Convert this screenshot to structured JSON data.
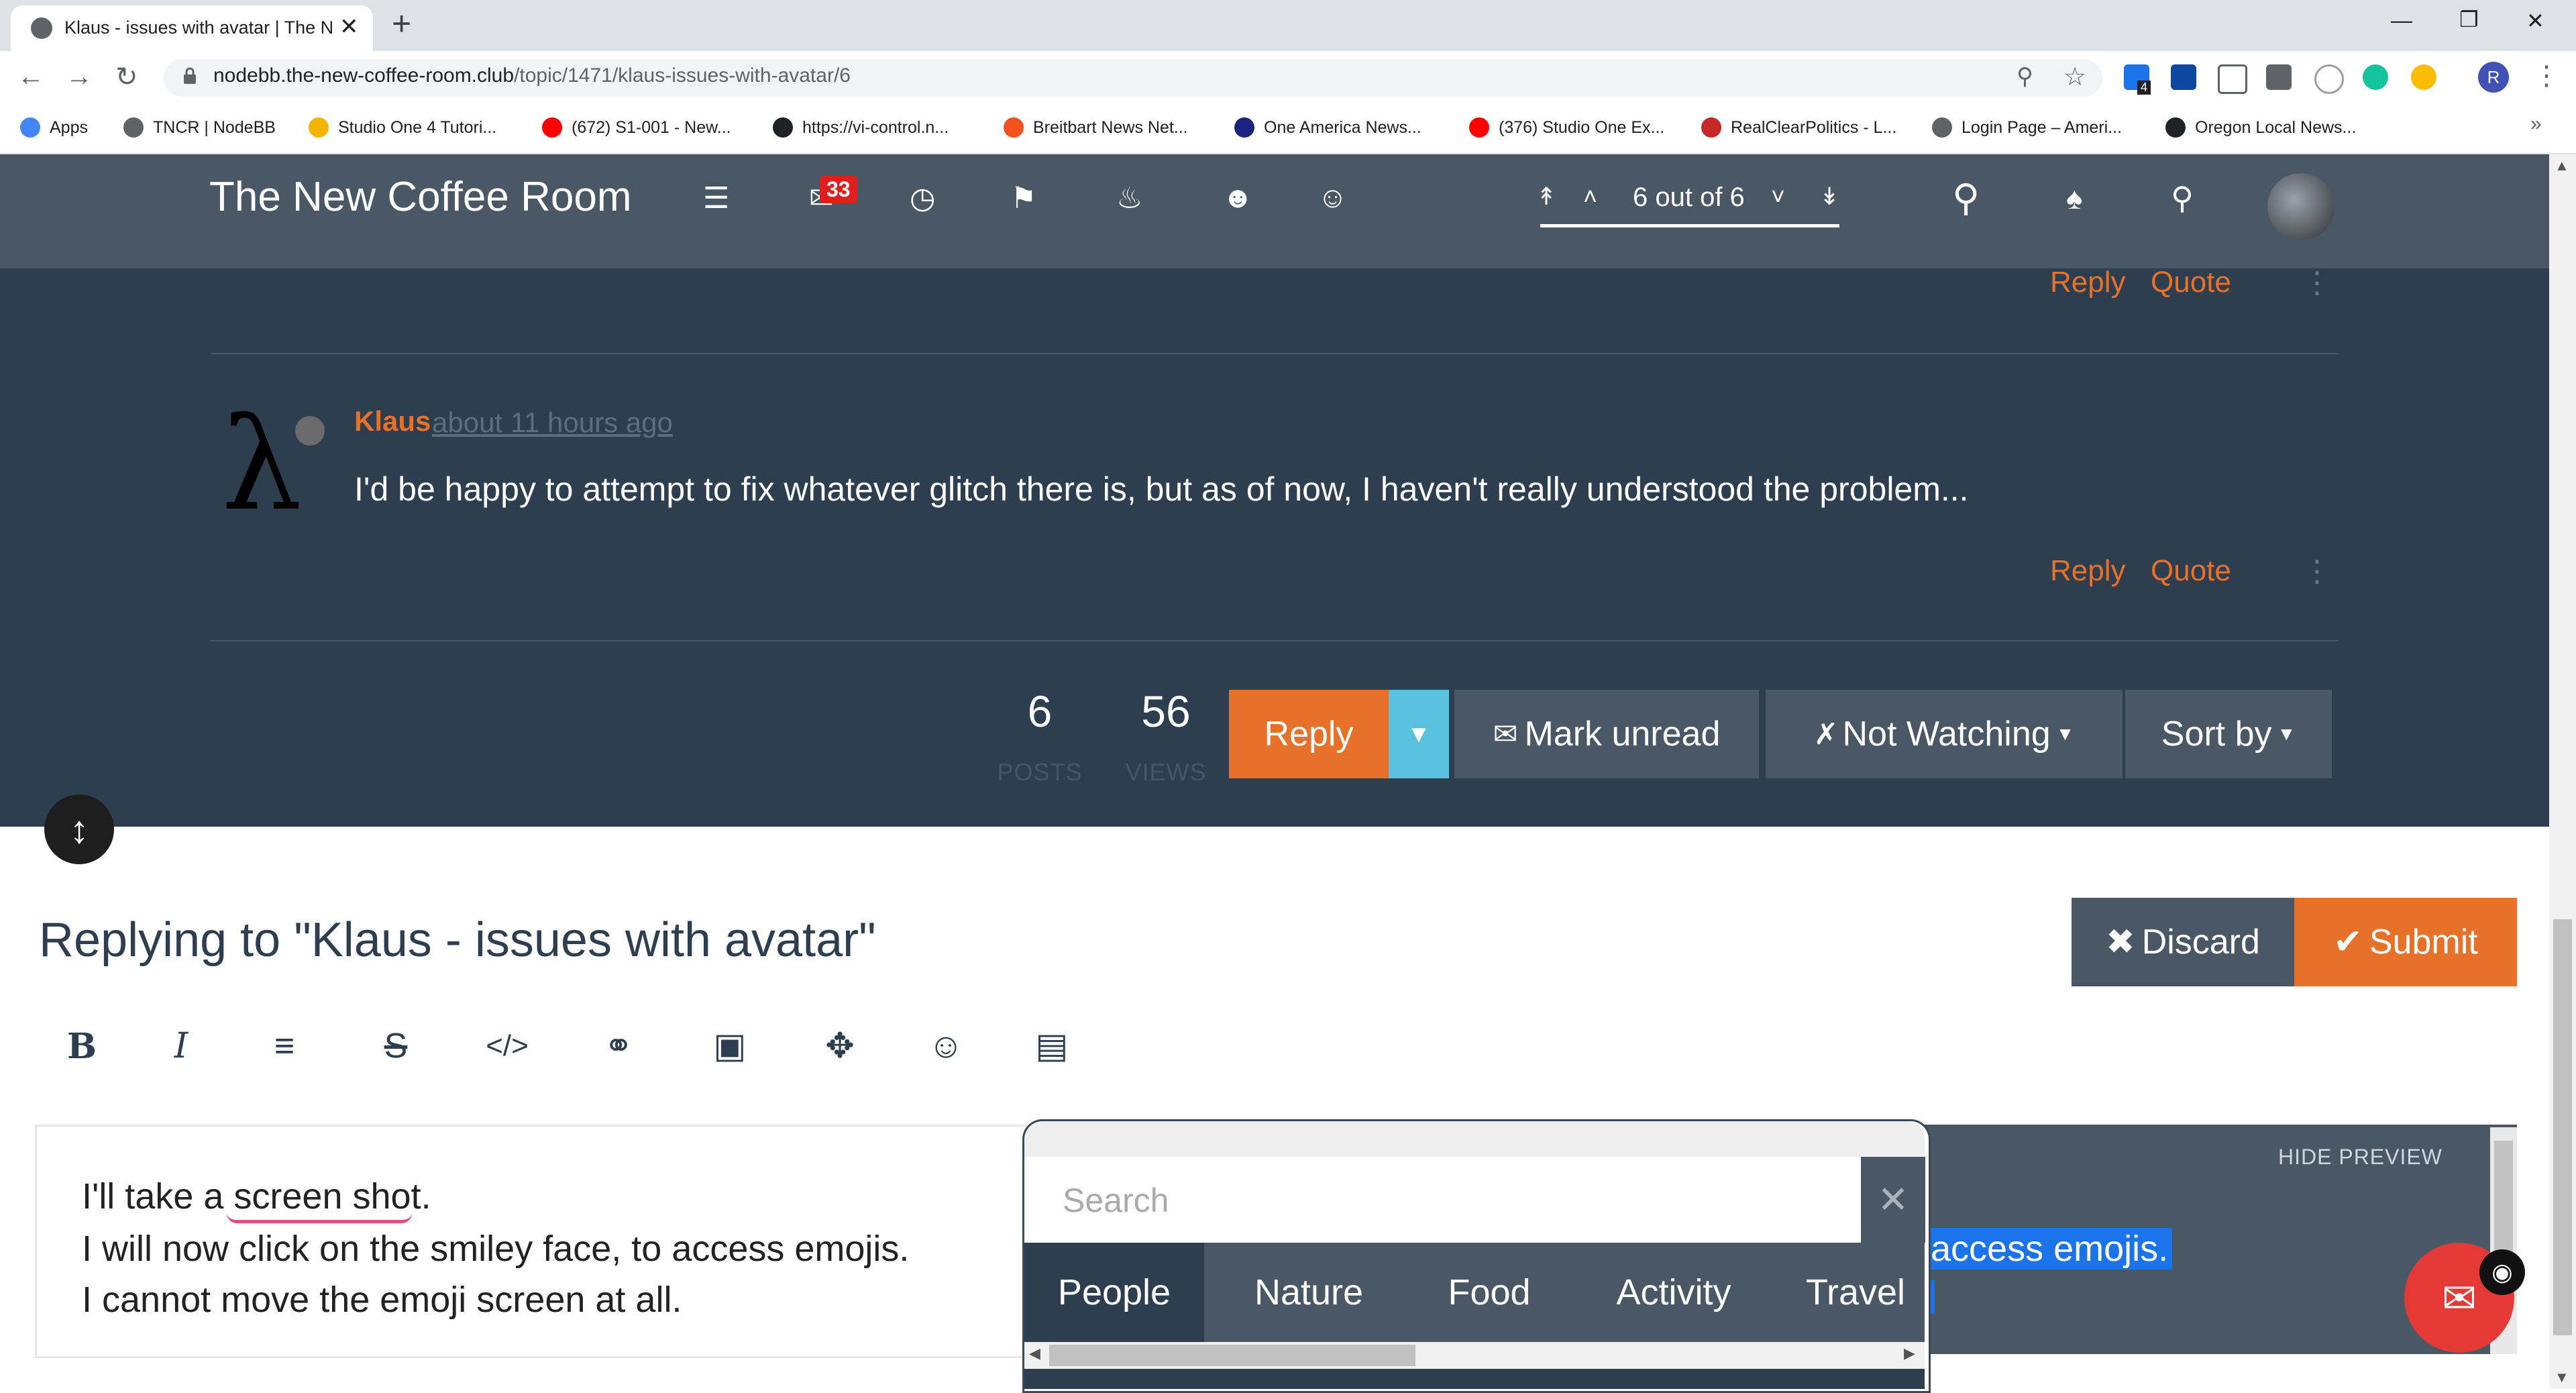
{
  "browser": {
    "tab_title": "Klaus - issues with avatar | The N",
    "tab_close": "✕",
    "new_tab": "+",
    "url_domain": "nodebb.the-new-coffee-room.club",
    "url_path": "/topic/1471/klaus-issues-with-avatar/6",
    "ext_badge": "4",
    "bookmarks": [
      {
        "label": "Apps",
        "icon": "apps-grid-icon",
        "color": "#4285f4"
      },
      {
        "label": "TNCR | NodeBB",
        "icon": "globe-icon",
        "color": "#5f6368"
      },
      {
        "label": "Studio One 4 Tutori...",
        "icon": "bars-icon",
        "color": "#f4b400"
      },
      {
        "label": "(672) S1-001 - New...",
        "icon": "youtube-icon",
        "color": "#ff0000"
      },
      {
        "label": "https://vi-control.n...",
        "icon": "g-icon",
        "color": "#202124"
      },
      {
        "label": "Breitbart News Net...",
        "icon": "b-icon",
        "color": "#f4511e"
      },
      {
        "label": "One America News...",
        "icon": "oan-icon",
        "color": "#1a237e"
      },
      {
        "label": "(376) Studio One Ex...",
        "icon": "youtube-icon",
        "color": "#ff0000"
      },
      {
        "label": "RealClearPolitics - L...",
        "icon": "rcp-icon",
        "color": "#c62828"
      },
      {
        "label": "Login Page – Ameri...",
        "icon": "globe-icon",
        "color": "#5f6368"
      },
      {
        "label": "Oregon Local News...",
        "icon": "oregon-icon",
        "color": "#202124"
      }
    ],
    "bookmarks_more": "»"
  },
  "navbar": {
    "brand": "The New Coffee Room",
    "notification_count": "33",
    "pager": "6 out of 6"
  },
  "post": {
    "actions_top": {
      "reply": "Reply",
      "quote": "Quote"
    },
    "avatar_glyph": "λ",
    "author": "Klaus",
    "timestamp": "about 11 hours ago",
    "body": "I'd be happy to attempt to fix whatever glitch there is, but as of now, I haven't really understood the problem...",
    "actions": {
      "reply": "Reply",
      "quote": "Quote"
    }
  },
  "topic_footer": {
    "posts_count": "6",
    "posts_label": "POSTS",
    "views_count": "56",
    "views_label": "VIEWS",
    "reply_button": "Reply",
    "mark_unread": "Mark unread",
    "watching": "Not Watching",
    "sort_by": "Sort by"
  },
  "composer": {
    "title": "Replying to \"Klaus - issues with avatar\"",
    "discard": "Discard",
    "submit": "Submit",
    "lines": [
      "I'll take a screen shot.",
      "I will now click on the smiley face, to access emojis.",
      "I cannot move the emoji screen at all."
    ],
    "hide_preview": "HIDE PREVIEW",
    "preview_selected": "access emojis."
  },
  "emoji_picker": {
    "search_placeholder": "Search",
    "close": "✕",
    "tabs": [
      "People",
      "Nature",
      "Food",
      "Activity",
      "Travel"
    ],
    "active_tab": "People"
  },
  "colors": {
    "navbar": "#4a5866",
    "content_bg": "#2d3e50",
    "accent_orange": "#e8712a",
    "caret_blue": "#5bc0de"
  }
}
